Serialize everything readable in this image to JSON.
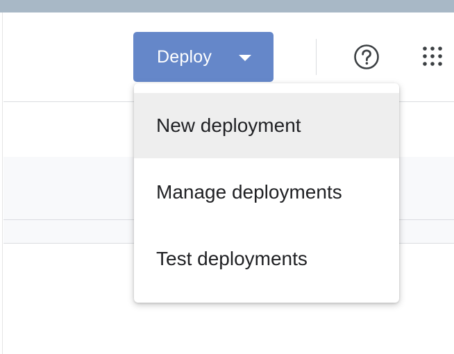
{
  "toolbar": {
    "deploy_label": "Deploy",
    "deploy_color": "#6587c9",
    "help_icon": "help-circle-icon",
    "apps_icon": "apps-grid-icon"
  },
  "deploy_menu": {
    "items": [
      {
        "label": "New deployment",
        "highlighted": true
      },
      {
        "label": "Manage deployments",
        "highlighted": false
      },
      {
        "label": "Test deployments",
        "highlighted": false
      }
    ]
  }
}
